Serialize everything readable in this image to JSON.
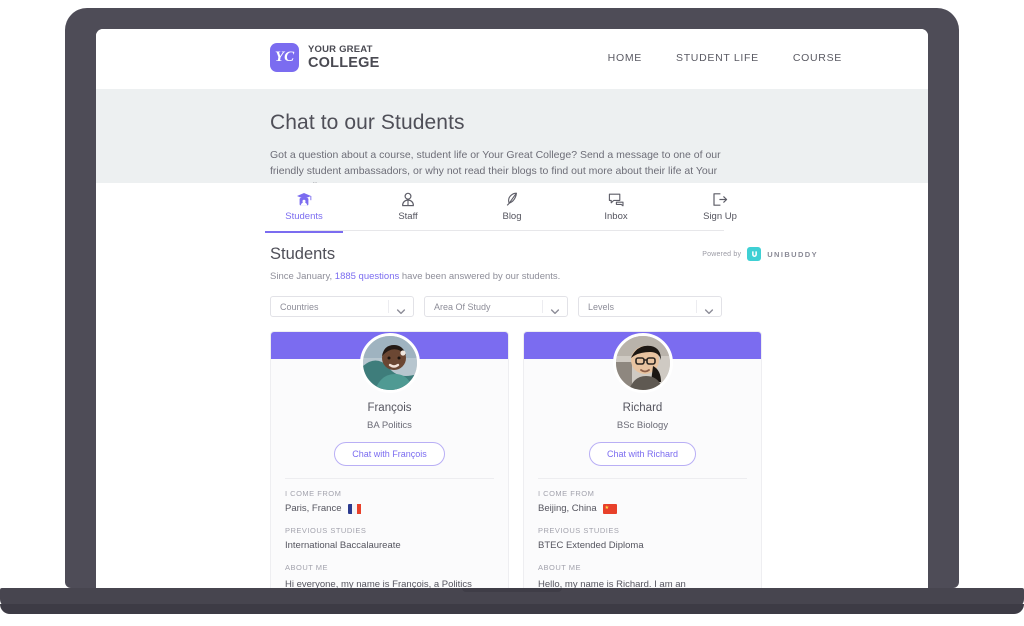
{
  "brand": {
    "mark": "YC",
    "line1": "YOUR GREAT",
    "line2": "COLLEGE",
    "accent": "#7b6cf0"
  },
  "site_nav": [
    {
      "label": "HOME"
    },
    {
      "label": "STUDENT LIFE"
    },
    {
      "label": "COURSE"
    }
  ],
  "hero": {
    "title": "Chat to our Students",
    "subtitle": "Got a question about a course, student life or Your Great College? Send a message to one of our friendly student ambassadors, or why not read their blogs to find out more about their life at Your Great College?"
  },
  "tabs": [
    {
      "label": "Students",
      "icon": "graduation-cap-icon",
      "active": true
    },
    {
      "label": "Staff",
      "icon": "person-icon",
      "active": false
    },
    {
      "label": "Blog",
      "icon": "feather-icon",
      "active": false
    },
    {
      "label": "Inbox",
      "icon": "chat-bubbles-icon",
      "active": false
    },
    {
      "label": "Sign Up",
      "icon": "sign-up-arrow-icon",
      "active": false
    }
  ],
  "section": {
    "title": "Students",
    "powered_by_label": "Powered by",
    "powered_by_brand": "UNIBUDDY",
    "powered_by_color": "#3fd0d4",
    "subline_prefix": "Since January, ",
    "subline_highlight": "1885 questions",
    "subline_suffix": " have been answered by our students."
  },
  "filters": [
    {
      "label": "Countries",
      "icon": "chevron-down-icon"
    },
    {
      "label": "Area Of Study",
      "icon": "chevron-down-icon"
    },
    {
      "label": "Levels",
      "icon": "chevron-down-icon"
    }
  ],
  "field_labels": {
    "come_from": "I COME FROM",
    "previous_studies": "PREVIOUS STUDIES",
    "about_me": "ABOUT ME"
  },
  "cards": [
    {
      "name": "François",
      "course": "BA Politics",
      "chat_label": "Chat with François",
      "come_from": "Paris, France",
      "flag": "fr",
      "previous_studies": "International Baccalaureate",
      "about_me": "Hi everyone, my name is François, a Politics student. I was born and r"
    },
    {
      "name": "Richard",
      "course": "BSc Biology",
      "chat_label": "Chat with Richard",
      "come_from": "Beijing, China",
      "flag": "cn",
      "previous_studies": "BTEC Extended Diploma",
      "about_me": "Hello, my name is Richard. I am an undergraduate student originally fr..."
    }
  ]
}
